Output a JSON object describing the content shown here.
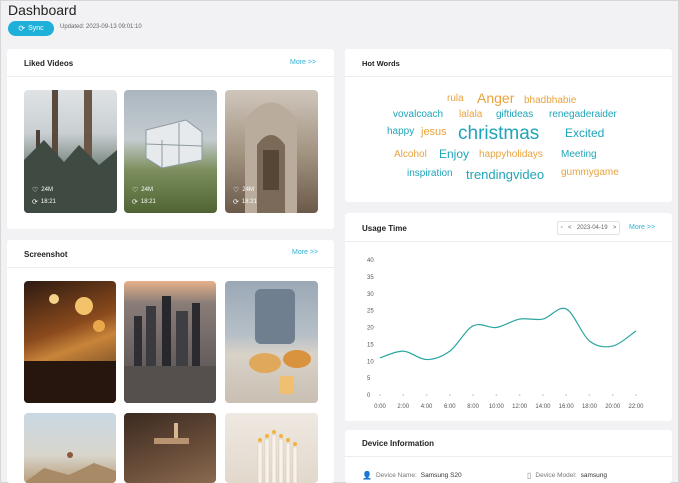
{
  "page": {
    "title": "Dashboard",
    "sync_label": "Sync",
    "updated_text": "Updated: 2023-09-13 09:01:10"
  },
  "liked_videos": {
    "title": "Liked Videos",
    "more": "More >>",
    "items": [
      {
        "likes": "24M",
        "date": "18:21"
      },
      {
        "likes": "24M",
        "date": "18:21"
      },
      {
        "likes": "24M",
        "date": "18:21"
      }
    ]
  },
  "screenshot": {
    "title": "Screenshot",
    "more": "More >>"
  },
  "hot_words": {
    "title": "Hot Words",
    "words": [
      {
        "text": "rula",
        "color": "#e8a33d"
      },
      {
        "text": "Anger",
        "color": "#e8a33d"
      },
      {
        "text": "bhadbhabie",
        "color": "#e8a33d"
      },
      {
        "text": "vovalcoach",
        "color": "#1fa5b9"
      },
      {
        "text": "lalala",
        "color": "#e8a33d"
      },
      {
        "text": "giftideas",
        "color": "#1fa5b9"
      },
      {
        "text": "renegaderaider",
        "color": "#1fa5b9"
      },
      {
        "text": "happy",
        "color": "#1fa5b9"
      },
      {
        "text": "jesus",
        "color": "#e8a33d"
      },
      {
        "text": "christmas",
        "color": "#1fa5b9"
      },
      {
        "text": "Excited",
        "color": "#1fa5b9"
      },
      {
        "text": "Alcohol",
        "color": "#e8a33d"
      },
      {
        "text": "Enjoy",
        "color": "#1fa5b9"
      },
      {
        "text": "happyholidays",
        "color": "#e8a33d"
      },
      {
        "text": "Meeting",
        "color": "#1fa5b9"
      },
      {
        "text": "inspiration",
        "color": "#1fa5b9"
      },
      {
        "text": "trendingvideo",
        "color": "#1fa5b9"
      },
      {
        "text": "gummygame",
        "color": "#e8a33d"
      }
    ]
  },
  "usage_time": {
    "title": "Usage Time",
    "date": "2023-04-19",
    "prev": "<",
    "next": ">",
    "more": "More >>"
  },
  "device_info": {
    "title": "Device Information",
    "name_label": "Device Name:",
    "name_value": "Samsung S20",
    "model_label": "Device Model:",
    "model_value": "samsung"
  },
  "chart_data": {
    "type": "line",
    "x": [
      "0:00",
      "2:00",
      "4:00",
      "6:00",
      "8:00",
      "10:00",
      "12:00",
      "14:00",
      "16:00",
      "18:00",
      "20:00",
      "22:00"
    ],
    "series": [
      {
        "values": [
          11,
          13,
          10.5,
          13,
          20.5,
          20,
          22.5,
          22.5,
          25.5,
          16,
          14.5,
          19
        ]
      }
    ],
    "ylim": [
      0,
      40
    ],
    "yticks": [
      0,
      5,
      10,
      15,
      20,
      25,
      30,
      35,
      40
    ],
    "grid": false,
    "color": "#2aa6a0"
  }
}
